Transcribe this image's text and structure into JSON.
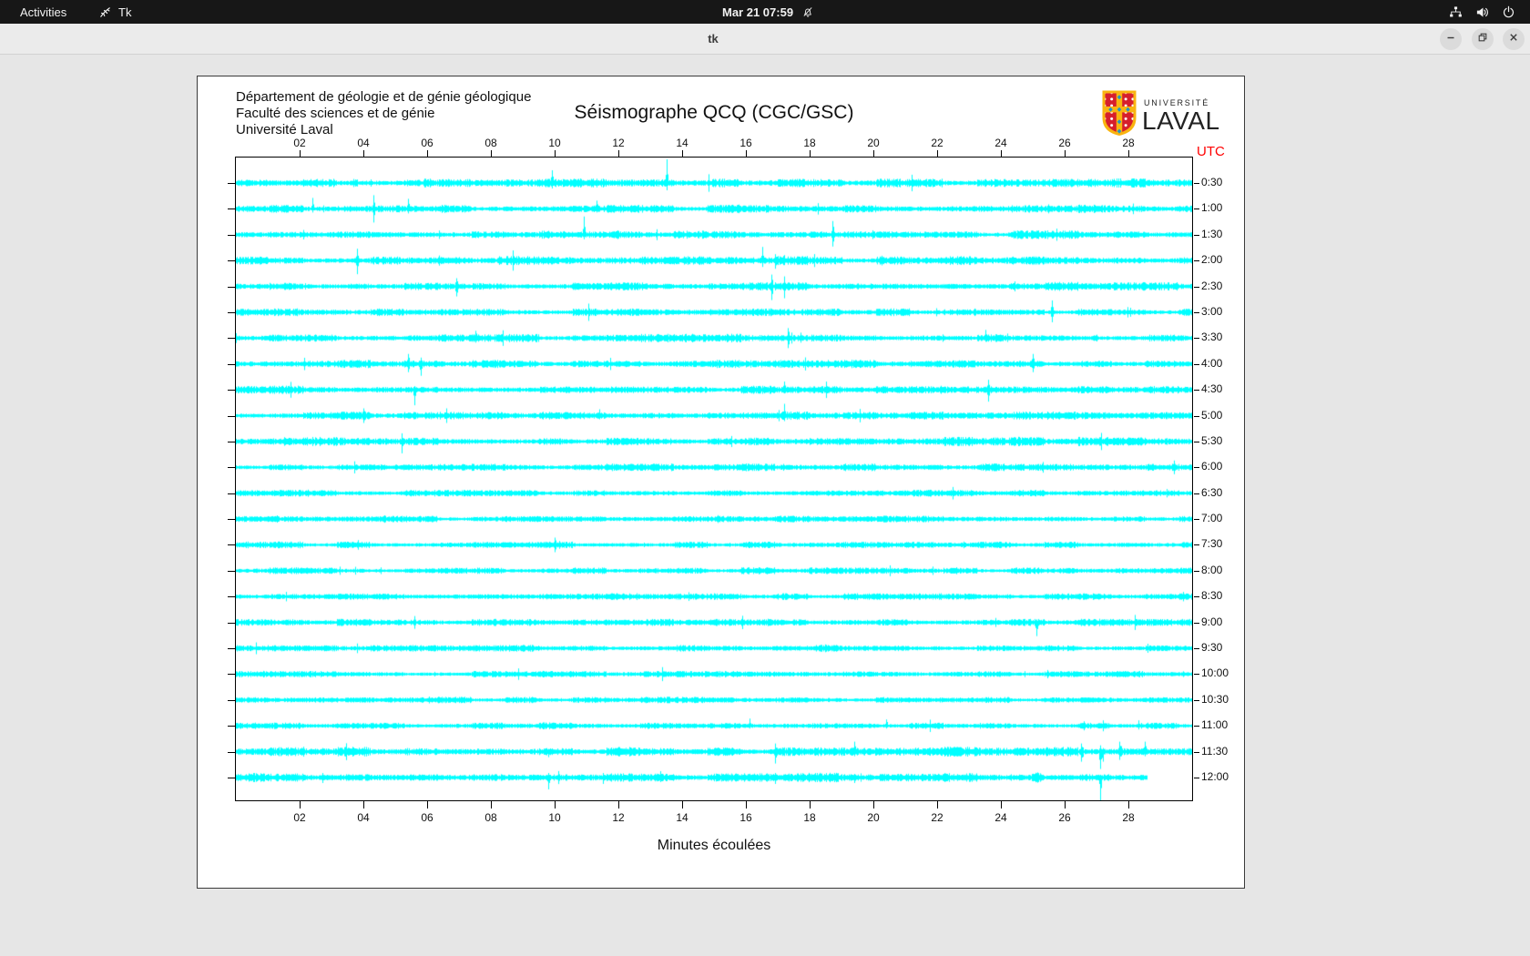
{
  "topbar": {
    "activities": "Activities",
    "app_name": "Tk",
    "clock": "Mar 21 07:59"
  },
  "titlebar": {
    "title": "tk"
  },
  "header": {
    "org_lines": [
      "Département de géologie et de génie géologique",
      "Faculté des sciences et de génie",
      "Université Laval"
    ],
    "title": "Séismographe QCQ (CGC/GSC)",
    "logo_top": "UNIVERSITÉ",
    "logo_bottom": "LAVAL"
  },
  "axis": {
    "utc": "UTC",
    "x_label": "Minutes écoulées",
    "x_tick_labels": [
      "02",
      "04",
      "06",
      "08",
      "10",
      "12",
      "14",
      "16",
      "18",
      "20",
      "22",
      "24",
      "26",
      "28"
    ]
  },
  "colors": {
    "trace": "#00ffff",
    "utc_label": "#ff0000",
    "laval_red": "#d61f2c",
    "laval_gold": "#f9b410",
    "laval_blue": "#2196c9"
  },
  "chart_data": {
    "type": "seismogram",
    "station": "QCQ (CGC/GSC)",
    "x_unit": "minutes",
    "x_range": [
      0,
      30
    ],
    "minutes_per_line": 30,
    "x_ticks": [
      2,
      4,
      6,
      8,
      10,
      12,
      14,
      16,
      18,
      20,
      22,
      24,
      26,
      28
    ],
    "utc_span": [
      "0:30",
      "12:00"
    ],
    "trace_color": "#00ffff",
    "rows": [
      {
        "utc": "0:30",
        "noise": 2.0,
        "spikes": [
          {
            "m": 3.7,
            "b": 4,
            "w": 6
          },
          {
            "m": 6.0,
            "b": 4,
            "w": 6
          },
          {
            "m": 9.9,
            "u": 14,
            "d": 6
          },
          {
            "m": 13.5,
            "u": 26,
            "d": 8
          },
          {
            "m": 25.9,
            "b": 3.5,
            "w": 4
          }
        ]
      },
      {
        "utc": "1:00",
        "noise": 2.0,
        "spikes": [
          {
            "m": 2.4,
            "u": 12,
            "d": 4
          },
          {
            "m": 4.3,
            "u": 15,
            "d": 15
          },
          {
            "m": 5.4,
            "u": 11,
            "d": 5
          },
          {
            "m": 11.3,
            "u": 9,
            "d": 4
          }
        ]
      },
      {
        "utc": "1:30",
        "noise": 2.0,
        "spikes": [
          {
            "m": 10.9,
            "u": 20,
            "d": 5
          },
          {
            "m": 11.9,
            "b": 4,
            "w": 5
          },
          {
            "m": 18.7,
            "u": 15,
            "d": 13
          }
        ]
      },
      {
        "utc": "2:00",
        "noise": 2.0,
        "spikes": [
          {
            "m": 3.8,
            "u": 13,
            "d": 15
          },
          {
            "m": 8.3,
            "b": 4,
            "w": 6
          },
          {
            "m": 16.5,
            "u": 15,
            "d": 7
          },
          {
            "m": 16.9,
            "u": 7,
            "d": 9
          },
          {
            "m": 17.2,
            "u": 6,
            "d": 5
          }
        ]
      },
      {
        "utc": "2:30",
        "noise": 2.0,
        "spikes": [
          {
            "m": 6.9,
            "u": 9,
            "d": 11
          },
          {
            "m": 12.1,
            "b": 4,
            "w": 6
          },
          {
            "m": 12.8,
            "b": 4,
            "w": 5
          },
          {
            "m": 16.8,
            "u": 13,
            "d": 15
          },
          {
            "m": 17.2,
            "u": 11,
            "d": 13
          }
        ]
      },
      {
        "utc": "3:00",
        "noise": 1.7,
        "spikes": [
          {
            "m": 25.6,
            "u": 13,
            "d": 11
          }
        ]
      },
      {
        "utc": "3:30",
        "noise": 1.9,
        "spikes": [
          {
            "m": 7.5,
            "u": 8,
            "d": 5
          },
          {
            "m": 8.3,
            "b": 4,
            "w": 4
          },
          {
            "m": 17.3,
            "u": 11,
            "d": 11
          },
          {
            "m": 17.7,
            "u": 6,
            "d": 5
          },
          {
            "m": 23.5,
            "u": 9,
            "d": 4
          },
          {
            "m": 24.2,
            "u": 5,
            "d": 4
          },
          {
            "m": 26.9,
            "b": 4,
            "w": 5
          }
        ]
      },
      {
        "utc": "4:00",
        "noise": 1.9,
        "spikes": [
          {
            "m": 5.4,
            "u": 11,
            "d": 9
          },
          {
            "m": 5.8,
            "u": 7,
            "d": 13
          },
          {
            "m": 25.0,
            "u": 11,
            "d": 9
          }
        ]
      },
      {
        "utc": "4:30",
        "noise": 1.8,
        "spikes": [
          {
            "m": 5.6,
            "u": 4,
            "d": 17
          },
          {
            "m": 17.2,
            "u": 9,
            "d": 4
          },
          {
            "m": 18.5,
            "u": 9,
            "d": 9
          },
          {
            "m": 23.6,
            "u": 11,
            "d": 13
          }
        ]
      },
      {
        "utc": "5:00",
        "noise": 1.8,
        "spikes": [
          {
            "m": 4.0,
            "u": 8,
            "d": 8
          },
          {
            "m": 6.6,
            "u": 8,
            "d": 8
          },
          {
            "m": 11.4,
            "u": 7,
            "d": 4
          },
          {
            "m": 17.2,
            "u": 13,
            "d": 6
          }
        ]
      },
      {
        "utc": "5:30",
        "noise": 2.1,
        "spikes": [
          {
            "m": 1.6,
            "b": 4,
            "w": 7
          },
          {
            "m": 5.2,
            "u": 9,
            "d": 13
          }
        ]
      },
      {
        "utc": "6:00",
        "noise": 1.7,
        "spikes": [
          {
            "m": 16.0,
            "b": 3.5,
            "w": 6
          },
          {
            "m": 17.1,
            "b": 3.5,
            "w": 3
          }
        ]
      },
      {
        "utc": "6:30",
        "noise": 1.5,
        "spikes": []
      },
      {
        "utc": "7:00",
        "noise": 1.5,
        "spikes": []
      },
      {
        "utc": "7:30",
        "noise": 1.5,
        "spikes": [
          {
            "m": 10.0,
            "u": 8,
            "d": 8
          }
        ]
      },
      {
        "utc": "8:00",
        "noise": 1.5,
        "spikes": []
      },
      {
        "utc": "8:30",
        "noise": 1.5,
        "spikes": []
      },
      {
        "utc": "9:00",
        "noise": 1.6,
        "spikes": [
          {
            "m": 5.6,
            "u": 7,
            "d": 7
          },
          {
            "m": 25.1,
            "u": 3,
            "d": 15
          }
        ]
      },
      {
        "utc": "9:30",
        "noise": 1.5,
        "spikes": []
      },
      {
        "utc": "10:00",
        "noise": 1.4,
        "spikes": []
      },
      {
        "utc": "10:30",
        "noise": 1.4,
        "spikes": []
      },
      {
        "utc": "11:00",
        "noise": 1.5,
        "spikes": [
          {
            "m": 16.1,
            "u": 8,
            "d": 3
          },
          {
            "m": 20.4,
            "u": 7,
            "d": 3
          },
          {
            "m": 26.6,
            "u": 5,
            "d": 5
          },
          {
            "m": 27.2,
            "u": 6,
            "d": 6
          },
          {
            "m": 28.3,
            "u": 6,
            "d": 4
          }
        ]
      },
      {
        "utc": "11:30",
        "noise": 2.2,
        "spikes": [
          {
            "m": 2.7,
            "u": 4,
            "d": 4
          },
          {
            "m": 9.8,
            "u": 2,
            "d": 6
          },
          {
            "m": 13.3,
            "u": 4,
            "d": 4
          },
          {
            "m": 16.9,
            "u": 9,
            "d": 13
          },
          {
            "m": 19.4,
            "u": 11,
            "d": 5
          },
          {
            "m": 23.0,
            "u": 5,
            "d": 4
          },
          {
            "m": 26.5,
            "u": 9,
            "d": 11,
            "w": 3
          },
          {
            "m": 27.1,
            "u": 7,
            "d": 19,
            "w": 4
          },
          {
            "m": 27.7,
            "u": 11,
            "d": 9,
            "w": 3
          },
          {
            "m": 28.5,
            "u": 11,
            "d": 5
          }
        ]
      },
      {
        "utc": "12:00",
        "noise": 2.2,
        "end": 28.6,
        "spikes": [
          {
            "m": 2.7,
            "u": 5,
            "d": 6
          },
          {
            "m": 9.8,
            "u": 5,
            "d": 13
          },
          {
            "m": 11.5,
            "u": 5,
            "d": 7
          },
          {
            "m": 13.3,
            "u": 7,
            "d": 5
          },
          {
            "m": 16.9,
            "u": 5,
            "d": 7
          },
          {
            "m": 19.4,
            "u": 4,
            "d": 6
          },
          {
            "m": 23.0,
            "u": 4,
            "d": 4
          },
          {
            "m": 25.1,
            "b": 5,
            "w": 10
          },
          {
            "m": 27.1,
            "u": 2,
            "d": 25
          }
        ]
      }
    ]
  }
}
